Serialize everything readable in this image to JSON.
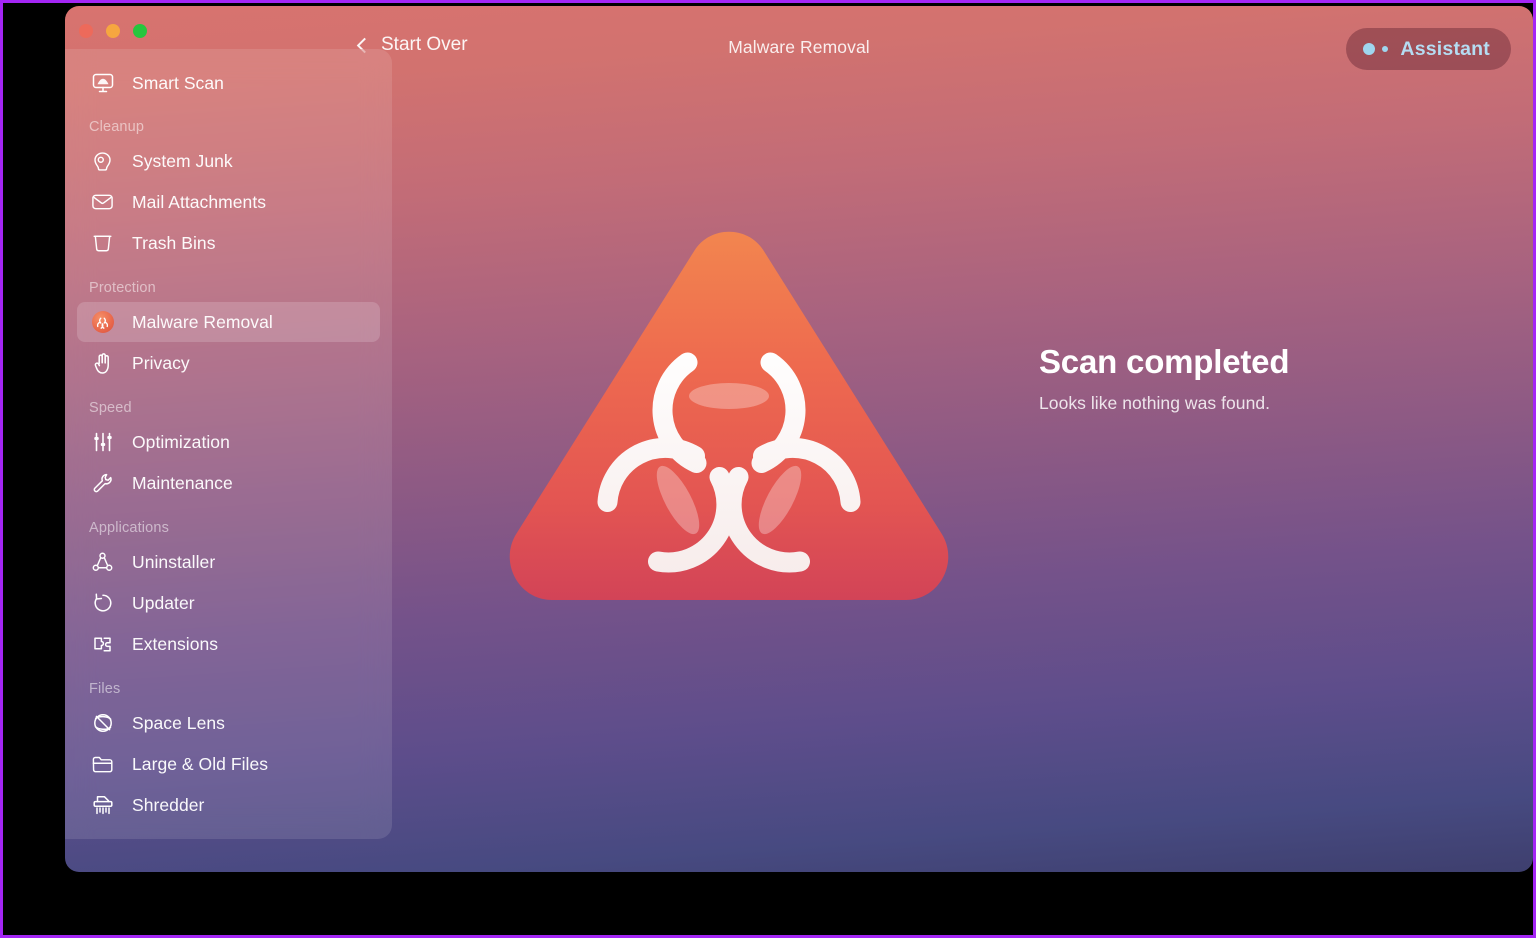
{
  "window": {
    "title": "Malware Removal",
    "traffic_lights": [
      {
        "name": "close",
        "color": "#ed6a5b"
      },
      {
        "name": "minimize",
        "color": "#f6a640"
      },
      {
        "name": "zoom",
        "color": "#26c63e"
      }
    ],
    "back_button_label": "Start Over",
    "assistant_button_label": "Assistant",
    "accent_blue": "#b5dcf2",
    "frame_color": "#a426f5",
    "background_gradient_top": "#d8736f",
    "background_gradient_bottom": "#3e3f6e"
  },
  "sidebar": {
    "groups": [
      {
        "header": null,
        "items": [
          {
            "label": "Smart Scan",
            "icon": "smart-scan-icon",
            "selected": false
          }
        ]
      },
      {
        "header": "Cleanup",
        "items": [
          {
            "label": "System Junk",
            "icon": "system-junk-icon",
            "selected": false
          },
          {
            "label": "Mail Attachments",
            "icon": "mail-attachments-icon",
            "selected": false
          },
          {
            "label": "Trash Bins",
            "icon": "trash-bins-icon",
            "selected": false
          }
        ]
      },
      {
        "header": "Protection",
        "items": [
          {
            "label": "Malware Removal",
            "icon": "biohazard-icon",
            "selected": true
          },
          {
            "label": "Privacy",
            "icon": "hand-icon",
            "selected": false
          }
        ]
      },
      {
        "header": "Speed",
        "items": [
          {
            "label": "Optimization",
            "icon": "sliders-icon",
            "selected": false
          },
          {
            "label": "Maintenance",
            "icon": "wrench-icon",
            "selected": false
          }
        ]
      },
      {
        "header": "Applications",
        "items": [
          {
            "label": "Uninstaller",
            "icon": "uninstaller-icon",
            "selected": false
          },
          {
            "label": "Updater",
            "icon": "updater-icon",
            "selected": false
          },
          {
            "label": "Extensions",
            "icon": "extensions-icon",
            "selected": false
          }
        ]
      },
      {
        "header": "Files",
        "items": [
          {
            "label": "Space Lens",
            "icon": "space-lens-icon",
            "selected": false
          },
          {
            "label": "Large & Old Files",
            "icon": "folder-icon",
            "selected": false
          },
          {
            "label": "Shredder",
            "icon": "shredder-icon",
            "selected": false
          }
        ]
      }
    ]
  },
  "main": {
    "hero_icon": "biohazard-warning-triangle-icon",
    "status_title": "Scan completed",
    "status_subtitle": "Looks like nothing was found."
  }
}
